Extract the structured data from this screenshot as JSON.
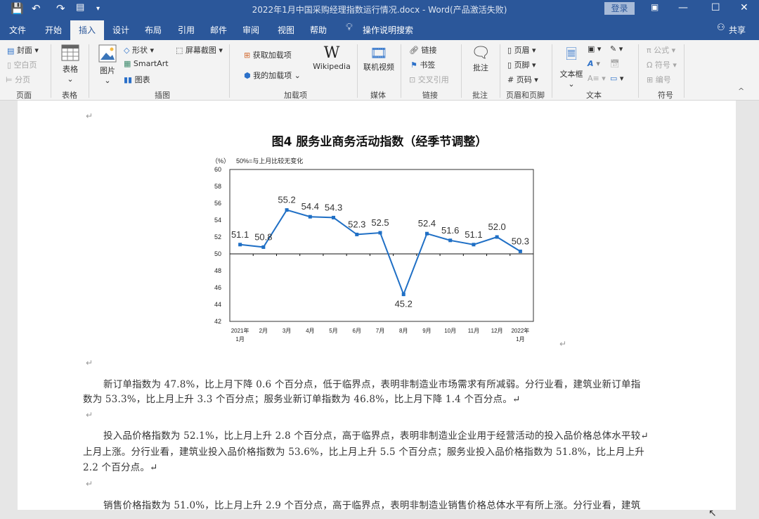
{
  "window": {
    "title": "2022年1月中国采购经理指数运行情况.docx  -  Word(产品激活失败)",
    "login": "登录"
  },
  "tabs": [
    "文件",
    "开始",
    "插入",
    "设计",
    "布局",
    "引用",
    "邮件",
    "审阅",
    "视图",
    "帮助",
    "操作说明搜索"
  ],
  "share": "共享",
  "ribbon": {
    "page": {
      "cover": "封面",
      "blank": "空白页",
      "break": "分页",
      "group": "页面"
    },
    "table": {
      "label": "表格",
      "group": "表格"
    },
    "illus": {
      "picture": "图片",
      "shapes": "形状",
      "smartart": "SmartArt",
      "chart": "图表",
      "screenshot": "屏幕截图",
      "group": "插图"
    },
    "addins": {
      "get": "获取加载项",
      "mine": "我的加载项",
      "wiki": "Wikipedia",
      "group": "加载项"
    },
    "media": {
      "video": "联机视频",
      "group": "媒体"
    },
    "links": {
      "link": "链接",
      "bookmark": "书签",
      "xref": "交叉引用",
      "group": "链接"
    },
    "comment": {
      "label": "批注",
      "group": "批注"
    },
    "hf": {
      "header": "页眉",
      "footer": "页脚",
      "pagenum": "页码",
      "group": "页眉和页脚"
    },
    "text": {
      "textbox": "文本框",
      "group": "文本"
    },
    "symbols": {
      "equation": "公式",
      "symbol": "符号",
      "number": "编号",
      "group": "符号"
    }
  },
  "chart_data": {
    "type": "line",
    "title": "图4  服务业商务活动指数（经季节调整）",
    "unit": "（%）",
    "note": "50%=与上月比较无变化",
    "categories": [
      [
        "2021年",
        "1月"
      ],
      [
        "2月"
      ],
      [
        "3月"
      ],
      [
        "4月"
      ],
      [
        "5月"
      ],
      [
        "6月"
      ],
      [
        "7月"
      ],
      [
        "8月"
      ],
      [
        "9月"
      ],
      [
        "10月"
      ],
      [
        "11月"
      ],
      [
        "12月"
      ],
      [
        "2022年",
        "1月"
      ]
    ],
    "values": [
      51.1,
      50.8,
      55.2,
      54.4,
      54.3,
      52.3,
      52.5,
      45.2,
      52.4,
      51.6,
      51.1,
      52.0,
      50.3
    ],
    "labels": [
      "51.1",
      "50.8",
      "55.2",
      "54.4",
      "54.3",
      "52.3",
      "52.5",
      "45.2",
      "52.4",
      "51.6",
      "51.1",
      "52.0",
      "50.3"
    ],
    "yticks": [
      "42",
      "44",
      "46",
      "48",
      "50",
      "52",
      "54",
      "56",
      "58",
      "60"
    ],
    "ylim": [
      42,
      60
    ],
    "reference": 50,
    "color": "#1f6fc5"
  },
  "paragraphs": [
    [
      "新订单指数为 47.8%，比上月下降 0.6 个百分点，低于临界点，表明非制造业市场需求有所减弱。分行业看，建筑业新订单指",
      "数为 53.3%，比上月上升 3.3 个百分点；服务业新订单指数为 46.8%，比上月下降 1.4 个百分点。↵"
    ],
    [
      "投入品价格指数为 52.1%，比上月上升 2.8 个百分点，高于临界点，表明非制造业企业用于经营活动的投入品价格总体水平较↵",
      "上月上涨。分行业看，建筑业投入品价格指数为 53.6%，比上月上升 5.5 个百分点；服务业投入品价格指数为 51.8%，比上月上升",
      "2.2 个百分点。↵"
    ],
    [
      "销售价格指数为 51.0%，比上月上升 2.9 个百分点，高于临界点，表明非制造业销售价格总体水平有所上涨。分行业看，建筑"
    ]
  ],
  "mark": "↵"
}
